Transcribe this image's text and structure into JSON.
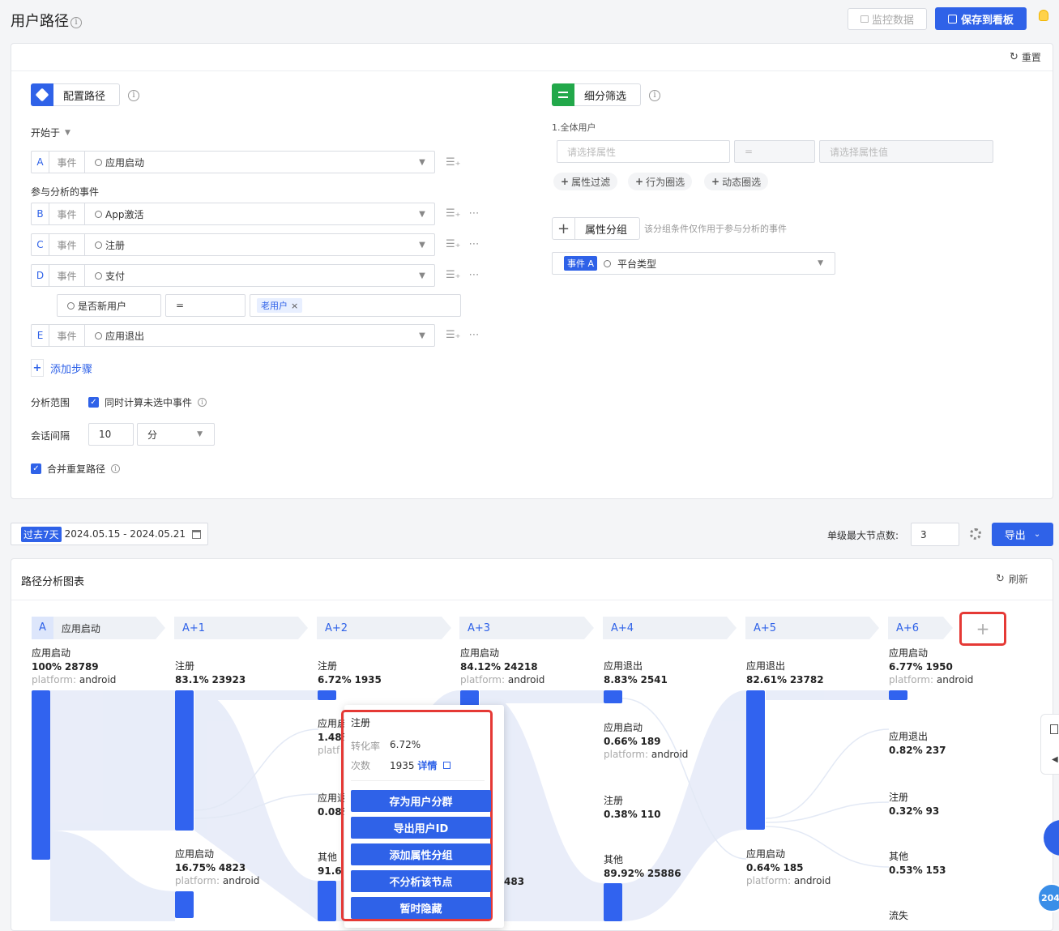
{
  "header": {
    "title": "用户路径",
    "monitor_label": "监控数据",
    "save_label": "保存到看板"
  },
  "config": {
    "reset": "重置",
    "configure_path": "配置路径",
    "start_with": "开始于",
    "participating": "参与分析的事件",
    "events": [
      {
        "letter": "A",
        "type": "事件",
        "name": "应用启动"
      },
      {
        "letter": "B",
        "type": "事件",
        "name": "App激活"
      },
      {
        "letter": "C",
        "type": "事件",
        "name": "注册"
      },
      {
        "letter": "D",
        "type": "事件",
        "name": "支付"
      },
      {
        "letter": "E",
        "type": "事件",
        "name": "应用退出"
      }
    ],
    "filter": {
      "prop": "是否新用户",
      "op": "=",
      "value": "老用户"
    },
    "add_step": "添加步骤",
    "scope_label": "分析范围",
    "scope_check": "同时计算未选中事件",
    "session_label": "会话间隔",
    "session_value": "10",
    "session_unit": "分",
    "merge_label": "合并重复路径"
  },
  "segment": {
    "title": "细分筛选",
    "group_title": "1.全体用户",
    "prop_placeholder": "请选择属性",
    "op": "=",
    "value_placeholder": "请选择属性值",
    "pills": [
      "属性过滤",
      "行为圈选",
      "动态圈选"
    ],
    "group_label": "属性分组",
    "group_note": "该分组条件仅作用于参与分析的事件",
    "group_event": "事件 A",
    "group_prop": "平台类型"
  },
  "date_bar": {
    "preset": "过去7天",
    "range": "2024.05.15 - 2024.05.21",
    "max_nodes_label": "单级最大节点数:",
    "max_nodes": "3",
    "export": "导出"
  },
  "chart": {
    "title": "路径分析图表",
    "refresh": "刷新",
    "steps": [
      "A",
      "A+1",
      "A+2",
      "A+3",
      "A+4",
      "A+5",
      "A+6"
    ],
    "first_step_name": "应用启动",
    "nodes": [
      [
        {
          "name": "应用启动",
          "pct": "100%",
          "count": "28789",
          "plat": "platform:",
          "platv": "android"
        }
      ],
      [
        {
          "name": "注册",
          "pct": "83.1%",
          "count": "23923"
        },
        {
          "name": "应用启动",
          "pct": "16.75%",
          "count": "4823",
          "plat": "platform:",
          "platv": "android"
        }
      ],
      [
        {
          "name": "注册",
          "pct": "6.72%",
          "count": "1935"
        },
        {
          "name": "应用启",
          "pct": "1.48%",
          "plat": "platf"
        },
        {
          "name": "应用退",
          "pct": "0.08%"
        },
        {
          "name": "其他",
          "pct": "91.6"
        }
      ],
      [
        {
          "name": "应用启动",
          "pct": "84.12%",
          "count": "24218",
          "plat": "platform:",
          "platv": "android"
        },
        {
          "count": "483"
        }
      ],
      [
        {
          "name": "应用退出",
          "pct": "8.83%",
          "count": "2541"
        },
        {
          "name": "应用启动",
          "pct": "0.66%",
          "count": "189",
          "plat": "platform:",
          "platv": "android"
        },
        {
          "name": "注册",
          "pct": "0.38%",
          "count": "110"
        },
        {
          "name": "其他",
          "pct": "89.92%",
          "count": "25886"
        }
      ],
      [
        {
          "name": "应用退出",
          "pct": "82.61%",
          "count": "23782"
        },
        {
          "name": "应用启动",
          "pct": "0.64%",
          "count": "185",
          "plat": "platform:",
          "platv": "android"
        }
      ],
      [
        {
          "name": "应用启动",
          "pct": "6.77%",
          "count": "1950",
          "plat": "platform:",
          "platv": "android"
        },
        {
          "name": "应用退出",
          "pct": "0.82%",
          "count": "237"
        },
        {
          "name": "注册",
          "pct": "0.32%",
          "count": "93"
        },
        {
          "name": "其他",
          "pct": "0.53%",
          "count": "153"
        },
        {
          "name": "流失"
        }
      ]
    ],
    "popup": {
      "title": "注册",
      "rate_label": "转化率",
      "rate": "6.72%",
      "count_label": "次数",
      "count": "1935",
      "detail": "详情",
      "actions": [
        "存为用户分群",
        "导出用户ID",
        "添加属性分组",
        "不分析该节点",
        "暂时隐藏"
      ]
    },
    "badge": "204"
  },
  "colors": {
    "primary": "#2f62e8",
    "bar": "#3163ef",
    "flow": "#dfe6f7",
    "highlight": "#e53935"
  }
}
